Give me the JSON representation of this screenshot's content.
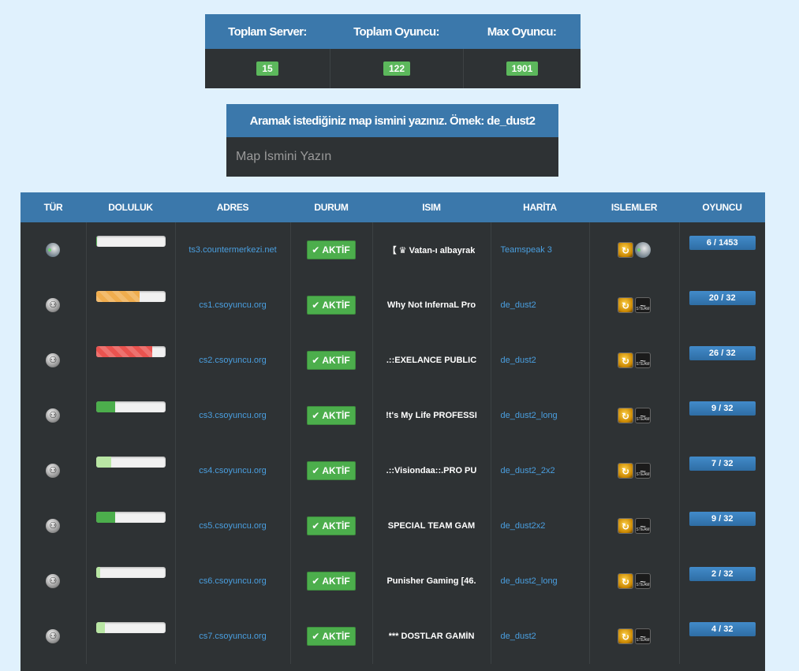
{
  "stats": {
    "headers": [
      "Toplam Server:",
      "Toplam Oyuncu:",
      "Max Oyuncu:"
    ],
    "values": [
      "15",
      "122",
      "1901"
    ]
  },
  "search": {
    "title": "Aramak istediğiniz map ismini yazınız. Ömek: de_dust2",
    "placeholder": "Map İsmini Yazın"
  },
  "table": {
    "columns": [
      "TÜR",
      "DOLULUK",
      "ADRES",
      "DURUM",
      "ISIM",
      "HARİTA",
      "ISLEMLER",
      "OYUNCU"
    ],
    "rows": [
      {
        "type_icon": "teamspeak-icon",
        "fill": 0.004,
        "fill_color": "#5cb85c",
        "address": "ts3.countermerkezi.net",
        "status": "AKTİF",
        "name": "【 ♛ Vatan-ı albayrak",
        "map": "Teamspeak 3",
        "op_icons": [
          "hlsw-icon",
          "teamspeak-icon"
        ],
        "players": "6 / 1453"
      },
      {
        "type_icon": "counter-strike-icon",
        "fill": 0.63,
        "fill_color": "#f0ad4e",
        "address": "cs1.csoyuncu.org",
        "status": "AKTİF",
        "name": "Why Not InfernaL Pro",
        "map": "de_dust2",
        "op_icons": [
          "hlsw-icon",
          "steam-icon"
        ],
        "players": "20 / 32"
      },
      {
        "type_icon": "counter-strike-icon",
        "fill": 0.81,
        "fill_color": "#e9534f",
        "address": "cs2.csoyuncu.org",
        "status": "AKTİF",
        "name": ".::EXELANCE PUBLIC",
        "map": "de_dust2",
        "op_icons": [
          "hlsw-icon",
          "steam-icon"
        ],
        "players": "26 / 32"
      },
      {
        "type_icon": "counter-strike-icon",
        "fill": 0.28,
        "fill_color": "#4cae4c",
        "address": "cs3.csoyuncu.org",
        "status": "AKTİF",
        "name": "!t's My Life PROFESSI",
        "map": "de_dust2_long",
        "op_icons": [
          "hlsw-icon",
          "steam-icon"
        ],
        "players": "9 / 32"
      },
      {
        "type_icon": "counter-strike-icon",
        "fill": 0.22,
        "fill_color": "#b9e6a4",
        "address": "cs4.csoyuncu.org",
        "status": "AKTİF",
        "name": ".::Visiondaa::.PRO PU",
        "map": "de_dust2_2x2",
        "op_icons": [
          "hlsw-icon",
          "steam-icon"
        ],
        "players": "7 / 32"
      },
      {
        "type_icon": "counter-strike-icon",
        "fill": 0.28,
        "fill_color": "#4cae4c",
        "address": "cs5.csoyuncu.org",
        "status": "AKTİF",
        "name": "SPECIAL TEAM GAM",
        "map": "de_dust2x2",
        "op_icons": [
          "hlsw-icon",
          "steam-icon"
        ],
        "players": "9 / 32"
      },
      {
        "type_icon": "counter-strike-icon",
        "fill": 0.06,
        "fill_color": "#b9e6a4",
        "address": "cs6.csoyuncu.org",
        "status": "AKTİF",
        "name": "Punisher Gaming [46.",
        "map": "de_dust2_long",
        "op_icons": [
          "hlsw-icon",
          "steam-icon"
        ],
        "players": "2 / 32"
      },
      {
        "type_icon": "counter-strike-icon",
        "fill": 0.125,
        "fill_color": "#b9e6a4",
        "address": "cs7.csoyuncu.org",
        "status": "AKTİF",
        "name": "*** DOSTLAR GAMİN",
        "map": "de_dust2",
        "op_icons": [
          "hlsw-icon",
          "steam-icon"
        ],
        "players": "4 / 32"
      }
    ]
  }
}
